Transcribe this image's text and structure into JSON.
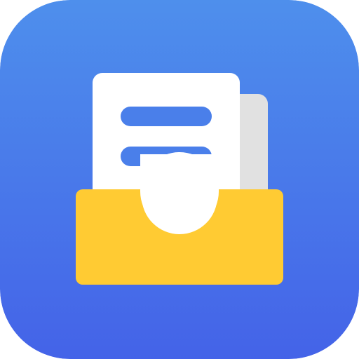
{
  "icon": {
    "name": "document-tray-app-icon",
    "symbol": "inbox-tray-with-documents",
    "colors": {
      "background_top": "#4E8FEC",
      "background_bottom": "#4463E8",
      "front_document": "#FFFFFF",
      "back_document": "#E1E1E1",
      "text_lines": "#4A7FEA",
      "tray": "#FFCB33"
    }
  }
}
